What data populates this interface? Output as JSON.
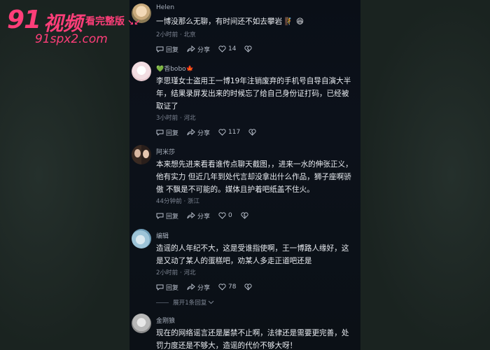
{
  "watermark": {
    "brand_num": "91",
    "brand_text": "视频",
    "badge": "看完整版",
    "arrows": "↘↙",
    "url": "91spx2.com"
  },
  "colors": {
    "accent": "#ff3e79",
    "panel_bg": "#0b1118",
    "text": "#e9ecf1",
    "muted": "#7d8593"
  },
  "actions": {
    "reply": "回复",
    "share": "分享"
  },
  "comments": [
    {
      "user": "Helen",
      "text": "一博没那么无聊，有时间还不如去攀岩 🧗 😆",
      "meta": "2小时前 · 北京",
      "likes": "14"
    },
    {
      "user_prefix": "💚",
      "user": "香bobo",
      "user_suffix": "🍁",
      "text": "李思瑾女士盗用王一博19年注销废弃的手机号自导自演大半年，结果录屏发出来的时候忘了给自己身份证打码，已经被取证了",
      "meta": "3小时前 · 河北",
      "likes": "117"
    },
    {
      "user": "阿米莎",
      "text": "本来想先进来看看谁传点聊天截图，，进来一水的伸张正义，他有实力 但近几年到处代言却没拿出什么作品，狮子座啊骄傲 不飘是不可能的。媒体且护着吧纸盖不住火。",
      "meta": "44分钟前 · 浙江",
      "likes": "0"
    },
    {
      "user": "编辑",
      "text": "造谣的人年纪不大，这是受谁指使啊，王一博路人缘好，这是又动了某人的蛋糕吧，劝某人多走正道吧还是",
      "meta": "2小时前 · 河北",
      "likes": "78"
    },
    {
      "user": "金刚狼",
      "text": "现在的网络谣言还是屡禁不止啊，法律还是需要更完善，处罚力度还是不够大，造谣的代价不够大呀！"
    }
  ],
  "expand_replies": "展开1条回复"
}
